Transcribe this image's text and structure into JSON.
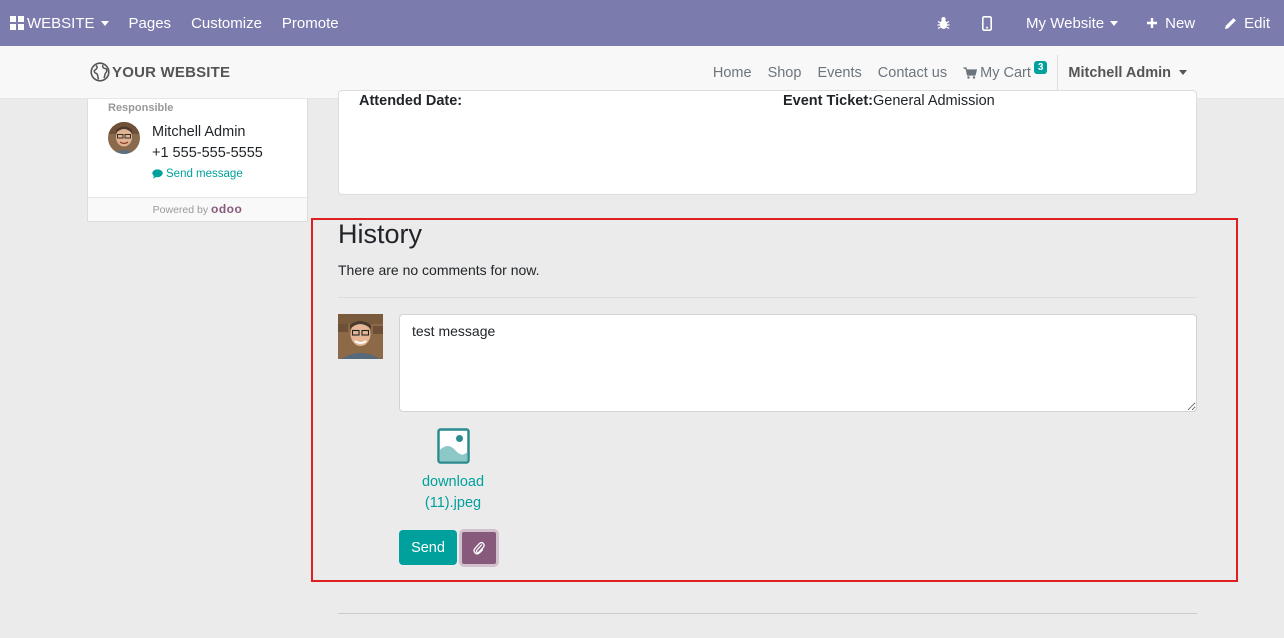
{
  "adminbar": {
    "brand": "WEBSITE",
    "menus": [
      "Pages",
      "Customize",
      "Promote"
    ],
    "website_selector": "My Website",
    "new_label": "New",
    "edit_label": "Edit"
  },
  "navbar": {
    "logo_text": "YOUR WEBSITE",
    "links": [
      "Home",
      "Shop",
      "Events",
      "Contact us"
    ],
    "cart_label": "My Cart",
    "cart_count": "3",
    "user_name": "Mitchell Admin"
  },
  "sidebar": {
    "responsible_label": "Responsible",
    "name": "Mitchell Admin",
    "phone": "+1 555-555-5555",
    "send_message": "Send message",
    "powered_by": "Powered by",
    "powered_brand": "odoo"
  },
  "details": {
    "attended_date_label": "Attended Date:",
    "event_ticket_label": "Event Ticket:",
    "event_ticket_value": "General Admission"
  },
  "history": {
    "title": "History",
    "no_comments": "There are no comments for now.",
    "message_value": "test message",
    "attachment_name": "download (11).jpeg",
    "send_label": "Send"
  },
  "colors": {
    "admin_bar": "#7c7bad",
    "primary": "#00a09d",
    "odoo_purple": "#875a7b",
    "highlight_border": "#e02020"
  },
  "icons": {
    "bug": "bug-icon",
    "mobile": "mobile-icon",
    "plus": "plus-icon",
    "pencil": "pencil-icon",
    "globe": "globe-icon",
    "cart": "cart-icon",
    "comment": "comment-icon",
    "image": "image-file-icon",
    "paperclip": "paperclip-icon"
  }
}
